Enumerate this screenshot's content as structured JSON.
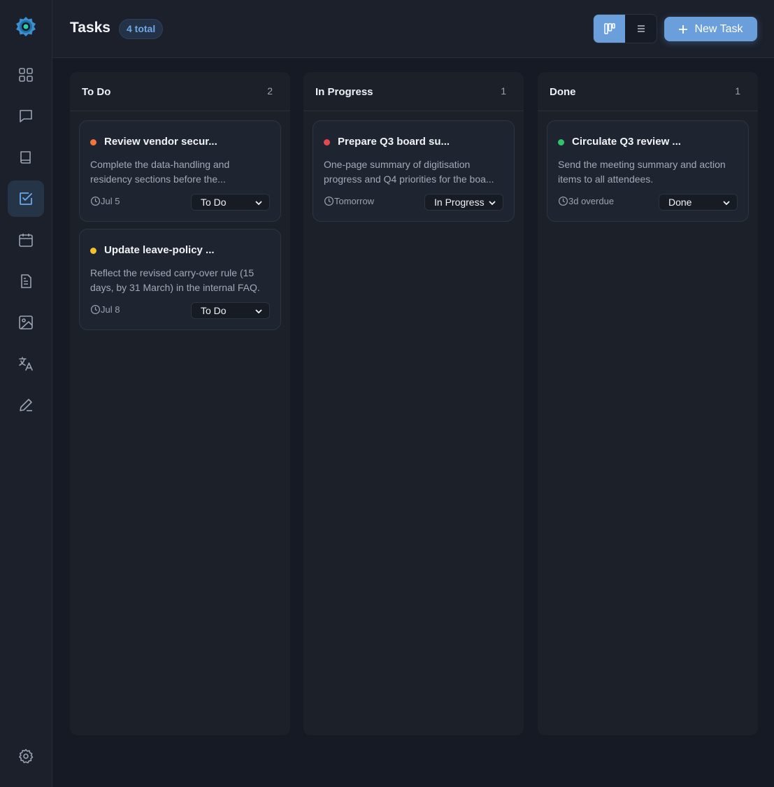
{
  "header": {
    "title": "Tasks",
    "count_badge": "4 total",
    "new_task_label": "New Task"
  },
  "sidebar": {
    "items": [
      {
        "icon": "dashboard-icon"
      },
      {
        "icon": "chat-icon"
      },
      {
        "icon": "book-icon"
      },
      {
        "icon": "tasks-icon",
        "active": true
      },
      {
        "icon": "calendar-icon"
      },
      {
        "icon": "document-icon"
      },
      {
        "icon": "image-icon"
      },
      {
        "icon": "translate-icon"
      },
      {
        "icon": "pen-icon"
      }
    ],
    "settings_icon": "gear-icon"
  },
  "columns": [
    {
      "title": "To Do",
      "count": "2",
      "cards": [
        {
          "title": "Review vendor secur...",
          "description": "Complete the data-handling and residency sections before the...",
          "date": "Jul 5",
          "status": "To Do",
          "priority_color": "#f0763a"
        },
        {
          "title": "Update leave-policy ...",
          "description": "Reflect the revised carry-over rule (15 days, by 31 March) in the internal FAQ.",
          "date": "Jul 8",
          "status": "To Do",
          "priority_color": "#f2c12e"
        }
      ]
    },
    {
      "title": "In Progress",
      "count": "1",
      "cards": [
        {
          "title": "Prepare Q3 board su...",
          "description": "One-page summary of digitisation progress and Q4 priorities for the boa...",
          "date": "Tomorrow",
          "status": "In Progress",
          "priority_color": "#e5484d"
        }
      ]
    },
    {
      "title": "Done",
      "count": "1",
      "cards": [
        {
          "title": "Circulate Q3 review ...",
          "description": "Send the meeting summary and action items to all attendees.",
          "date": "3d overdue",
          "status": "Done",
          "priority_color": "#31c46c"
        }
      ]
    }
  ],
  "colors": {
    "accent": "#6b9fdc",
    "background": "#151a24",
    "panel": "#1b202b"
  }
}
